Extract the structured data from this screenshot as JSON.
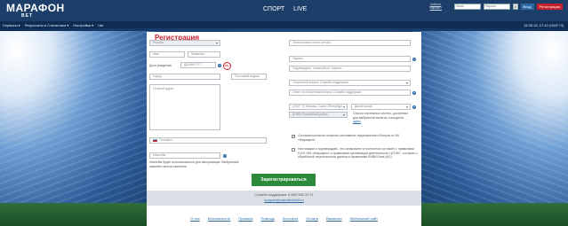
{
  "header": {
    "logo": "МАРАФОН",
    "logo_sub": "BET",
    "nav": [
      "СПОРТ",
      "LIVE"
    ],
    "forgot": "Забыли пароль?",
    "login_placeholder": "Логин",
    "password_placeholder": "Пароль",
    "login_button": "Вход",
    "register_button": "Регистрация"
  },
  "menubar": {
    "items": [
      "Сервисы ▾",
      "Результаты и Статистика ▾",
      "Настройки ▾",
      "Чат"
    ],
    "datetime": "15.05.15, 17:10 (GMT+3)"
  },
  "form": {
    "title": "Регистрация",
    "country": "Россия",
    "first_name": "Имя",
    "last_name": "Фамилия",
    "dob_label": "Дата рождения",
    "dob_value": "ДД.ММ.ГГГГ",
    "age_badge": "18+",
    "city": "Город",
    "postal": "Почтовый индекс",
    "address": "Полный адрес",
    "phone": "Телефон",
    "nickname": "Никнейм",
    "nickname_note": "Никнейм будет использоваться для авторизации. Выбранный никнейм нельзя изменить.",
    "email": "Электронная почта (email)",
    "password": "Пароль",
    "password_confirm": "Подтвердите, пожалуйста, пароль",
    "secret_question": "Секретный вопрос Службы поддержки",
    "secret_answer": "Ответ на секретный вопрос Службы поддержки",
    "timezone": "(GMT+3) Москва, Санкт-Петербург",
    "odds_format": "Десятичный",
    "currency": "(RUB) Российский рубль",
    "currency_note": "Список платежных систем, доступных для выбранной валюты, находится",
    "currency_link": "здесь",
    "promo_consent": "Согласие/согласна получать рекламные предложения и бонусы от БК «Марафон».",
    "terms_consent": "Настоящим я подтверждаю, что ознакомлен и полностью согласен с правилами ООО «БК «Марафон» и правилами организации деятельности ЦУПИС, согласен с обработкой персональных данных и правилами КИВИ Банк (АО).",
    "submit": "Зарегистрироваться"
  },
  "support": {
    "line1": "Служба поддержки: 8 800 550 20 11",
    "email": "support@marathonbet.ru"
  },
  "footer": {
    "links": [
      "О нас",
      "Безопасность",
      "Правила",
      "Помощь",
      "Контакты",
      "Оплата",
      "Вакансии",
      "Мобильный сайт"
    ]
  }
}
